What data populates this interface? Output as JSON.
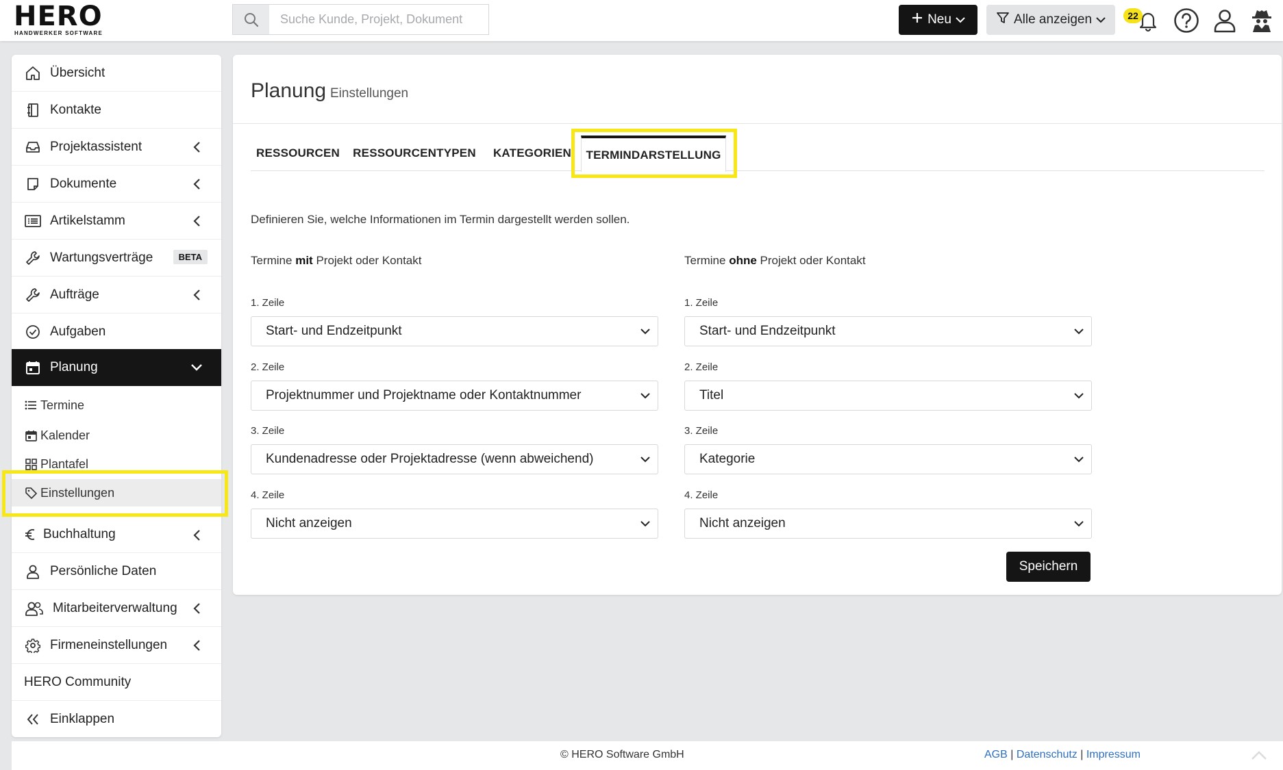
{
  "header": {
    "logo_word": "HERO",
    "logo_tagline": "HANDWERKER SOFTWARE",
    "search_placeholder": "Suche Kunde, Projekt, Dokument",
    "new_button": "Neu",
    "filter_button": "Alle anzeigen",
    "notification_count": "22"
  },
  "sidebar": {
    "items": [
      {
        "label": "Übersicht",
        "icon": "home-icon"
      },
      {
        "label": "Kontakte",
        "icon": "address-book-icon"
      },
      {
        "label": "Projektassistent",
        "icon": "inbox-icon"
      },
      {
        "label": "Dokumente",
        "icon": "document-icon"
      },
      {
        "label": "Artikelstamm",
        "icon": "list-icon"
      },
      {
        "label": "Wartungsverträge",
        "icon": "wrench-icon",
        "badge": "BETA"
      },
      {
        "label": "Aufträge",
        "icon": "wrench-icon"
      },
      {
        "label": "Aufgaben",
        "icon": "check-circle-icon"
      },
      {
        "label": "Planung",
        "icon": "calendar-icon"
      }
    ],
    "sub_items": [
      {
        "label": "Termine",
        "icon": "list-icon"
      },
      {
        "label": "Kalender",
        "icon": "calendar-icon"
      },
      {
        "label": "Plantafel",
        "icon": "grid-icon"
      },
      {
        "label": "Einstellungen",
        "icon": "tag-icon"
      }
    ],
    "items_after": [
      {
        "label": "Buchhaltung",
        "icon": "euro-icon"
      },
      {
        "label": "Persönliche Daten",
        "icon": "user-icon"
      },
      {
        "label": "Mitarbeiterverwaltung",
        "icon": "users-icon"
      },
      {
        "label": "Firmeneinstellungen",
        "icon": "gear-icon"
      },
      {
        "label": "HERO Community",
        "icon": ""
      },
      {
        "label": "Einklappen",
        "icon": "double-chevron-left-icon"
      }
    ]
  },
  "page": {
    "title": "Planung",
    "subtitle": "Einstellungen",
    "tabs": [
      "RESSOURCEN",
      "RESSOURCENTYPEN",
      "KATEGORIEN",
      "TERMINDARSTELLUNG"
    ],
    "active_tab": "TERMINDARSTELLUNG",
    "description": "Definieren Sie, welche Informationen im Termin dargestellt werden sollen.",
    "left_column": {
      "title_prefix": "Termine",
      "title_bold": "mit",
      "title_suffix": "Projekt oder Kontakt",
      "rows": [
        {
          "label": "1. Zeile",
          "value": "Start- und Endzeitpunkt"
        },
        {
          "label": "2. Zeile",
          "value": "Projektnummer und Projektname oder Kontaktnummer"
        },
        {
          "label": "3. Zeile",
          "value": "Kundenadresse oder Projektadresse (wenn abweichend)"
        },
        {
          "label": "4. Zeile",
          "value": "Nicht anzeigen"
        }
      ]
    },
    "right_column": {
      "title_prefix": "Termine",
      "title_bold": "ohne",
      "title_suffix": "Projekt oder Kontakt",
      "rows": [
        {
          "label": "1. Zeile",
          "value": "Start- und Endzeitpunkt"
        },
        {
          "label": "2. Zeile",
          "value": "Titel"
        },
        {
          "label": "3. Zeile",
          "value": "Kategorie"
        },
        {
          "label": "4. Zeile",
          "value": "Nicht anzeigen"
        }
      ]
    },
    "save_button": "Speichern"
  },
  "footer": {
    "copyright": "© HERO Software GmbH",
    "link_agb": "AGB",
    "link_privacy": "Datenschutz",
    "link_imprint": "Impressum",
    "separator": "|"
  },
  "colors": {
    "highlight": "#f7e716",
    "dark": "#151515",
    "link": "#2e6fc2",
    "badge": "#f5e21a"
  }
}
